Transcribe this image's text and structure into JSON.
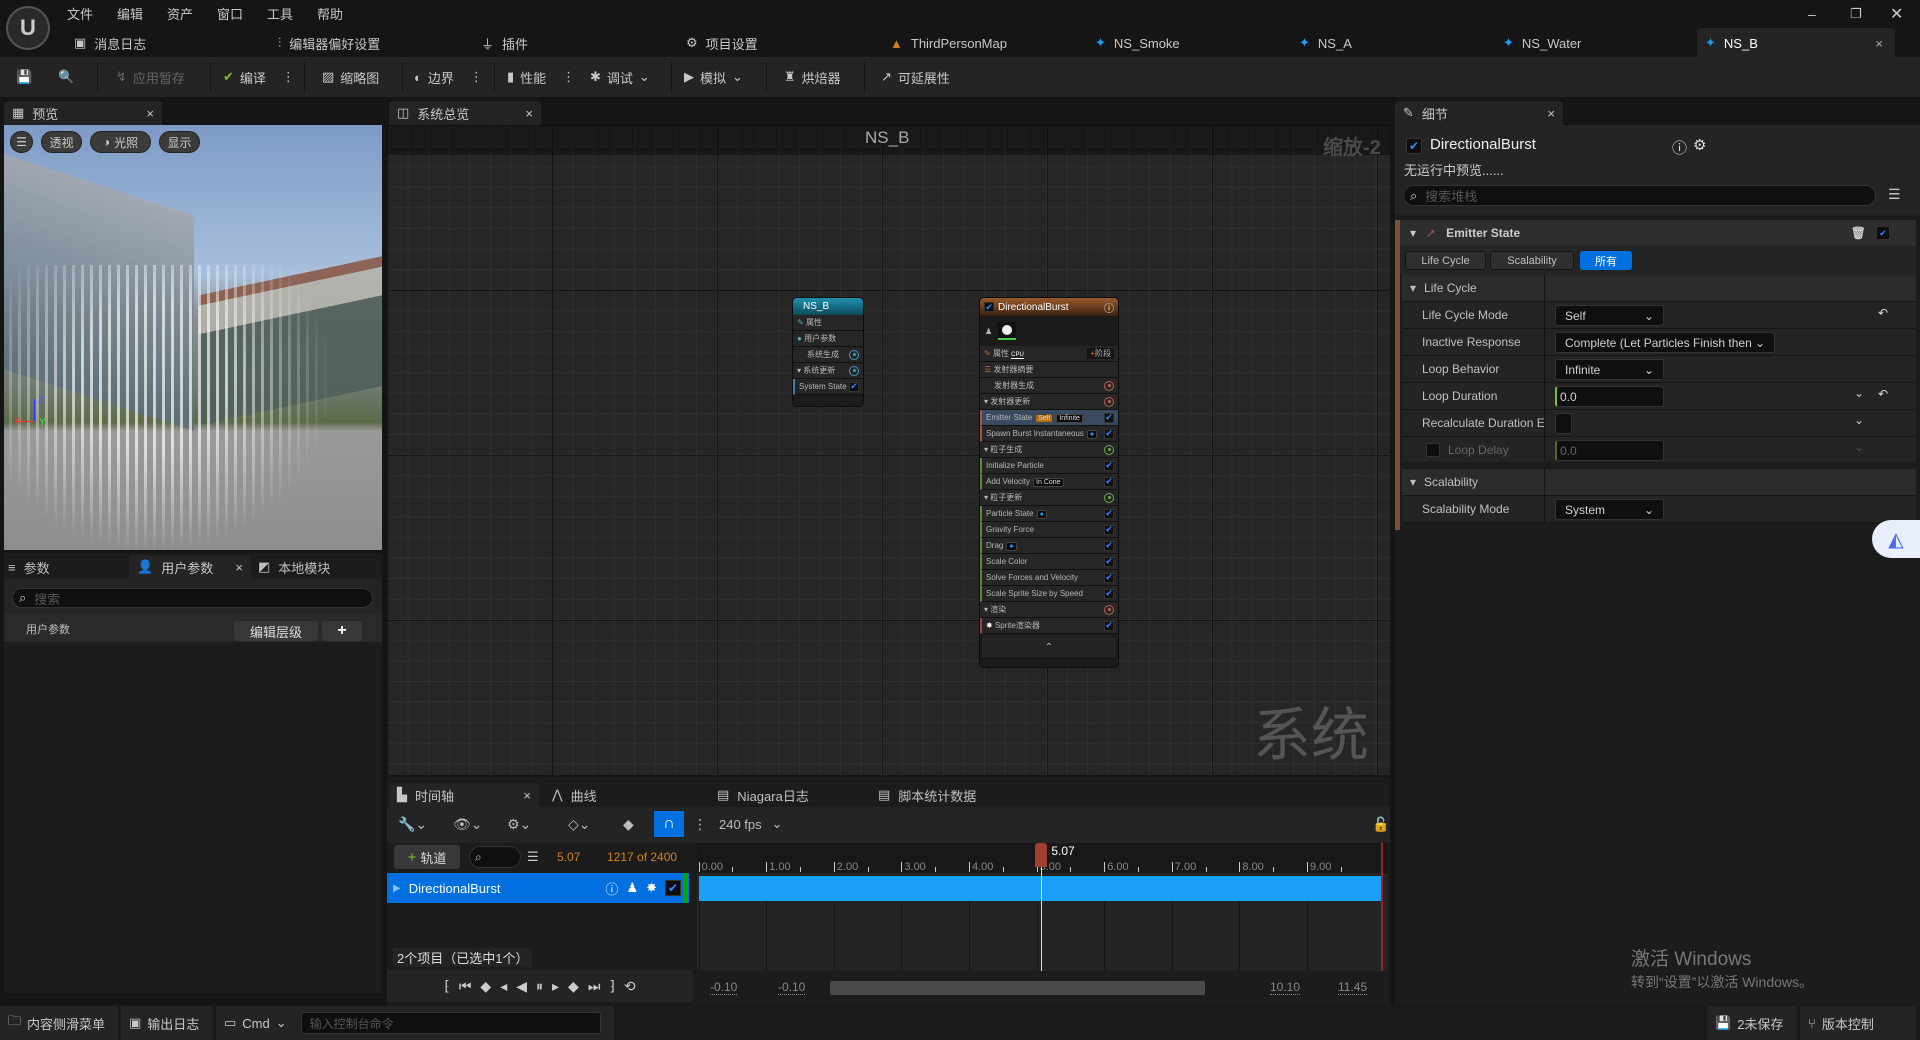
{
  "menu": [
    "文件",
    "编辑",
    "资产",
    "窗口",
    "工具",
    "帮助"
  ],
  "doc_tabs": [
    "消息日志",
    "编辑器偏好设置",
    "插件",
    "项目设置",
    "ThirdPersonMap",
    "NS_Smoke",
    "NS_A",
    "NS_Water",
    "NS_B"
  ],
  "toolbar": {
    "apply": "应用暂存",
    "compile": "编译",
    "thumbnail": "缩略图",
    "bounds": "边界",
    "performance": "性能",
    "debug": "调试",
    "simulate": "模拟",
    "baker": "烘焙器",
    "scalability": "可延展性"
  },
  "preview": {
    "tab": "预览",
    "perspective": "透视",
    "lit": "光照",
    "show": "显示",
    "axes": {
      "x": "X",
      "y": "Y",
      "z": "Z"
    }
  },
  "params": {
    "tabs": [
      "参数",
      "用户参数",
      "本地模块"
    ],
    "search_placeholder": "搜索",
    "row_label": "用户参数",
    "edit_hierarchy": "编辑层级",
    "add": "+"
  },
  "graph": {
    "tab": "系统总览",
    "title": "NS_B",
    "zoom": "缩放-2",
    "watermark": "系统"
  },
  "system_node": {
    "title": "NS_B",
    "rows": [
      "属性",
      "用户参数",
      "系统生成",
      "系统更新",
      "System State"
    ]
  },
  "emitter_node": {
    "title": "DirectionalBurst",
    "properties": "属性",
    "cpu": "CPU",
    "stage": "阶段",
    "rows": [
      {
        "t": "发射器摘要",
        "k": "sec0"
      },
      {
        "t": "发射器生成",
        "k": "sec"
      },
      {
        "t": "发射器更新",
        "k": "secx",
        "c": "#c0604a"
      },
      {
        "t": "Emitter State",
        "k": "mod",
        "tags": [
          "Self",
          "Infinite"
        ],
        "sel": true
      },
      {
        "t": "Spawn Burst Instantaneous",
        "k": "mod",
        "dot": true
      },
      {
        "t": "粒子生成",
        "k": "secx",
        "c": "#6aa84f"
      },
      {
        "t": "Initialize Particle",
        "k": "mod"
      },
      {
        "t": "Add Velocity",
        "k": "mod",
        "tags": [
          "In Cone"
        ]
      },
      {
        "t": "粒子更新",
        "k": "secx",
        "c": "#6aa84f"
      },
      {
        "t": "Particle State",
        "k": "mod",
        "dot": true
      },
      {
        "t": "Gravity Force",
        "k": "mod"
      },
      {
        "t": "Drag",
        "k": "mod",
        "dot": true
      },
      {
        "t": "Scale Color",
        "k": "mod"
      },
      {
        "t": "Solve Forces and Velocity",
        "k": "mod"
      },
      {
        "t": "Scale Sprite Size by Speed",
        "k": "mod"
      },
      {
        "t": "渲染",
        "k": "secx",
        "c": "#c0604a"
      },
      {
        "t": "Sprite渲染器",
        "k": "mod"
      }
    ]
  },
  "details": {
    "tab": "细节",
    "title": "DirectionalBurst",
    "subtitle": "无运行中预览......",
    "search_placeholder": "搜索堆栈",
    "module": "Emitter State",
    "filters": [
      "Life Cycle",
      "Scalability",
      "所有"
    ],
    "life_cycle": {
      "header": "Life Cycle",
      "rows": [
        {
          "label": "Life Cycle Mode",
          "value": "Self"
        },
        {
          "label": "Inactive Response",
          "value": "Complete (Let Particles Finish then"
        },
        {
          "label": "Loop Behavior",
          "value": "Infinite"
        },
        {
          "label": "Loop Duration",
          "value": "0.0"
        },
        {
          "label": "Recalculate Duration Ea",
          "value": ""
        },
        {
          "label": "Loop Delay",
          "value": "0.0"
        }
      ]
    },
    "scalability": {
      "header": "Scalability",
      "mode_label": "Scalability Mode",
      "mode_value": "System"
    }
  },
  "timeline": {
    "tabs": [
      "时间轴",
      "曲线",
      "Niagara日志",
      "脚本统计数据"
    ],
    "fps": "240 fps",
    "add_track": "轨道",
    "current_time": "5.07",
    "frame": "1217 of 2400",
    "track": "DirectionalBurst",
    "items": "2个项目（已选中1个）",
    "ticks": [
      "0.00",
      "1.00",
      "2.00",
      "3.00",
      "4.00",
      "5.00",
      "6.00",
      "7.00",
      "8.00",
      "9.00"
    ],
    "playhead": 5.07,
    "end": 10.1,
    "view_start": "-0.10",
    "play_start": "-0.10",
    "play_end": "10.10",
    "view_end": "11.45"
  },
  "statusbar": {
    "content_drawer": "内容侧滑菜单",
    "output_log": "输出日志",
    "cmd": "Cmd",
    "console_placeholder": "输入控制台命令",
    "unsaved": "2未保存",
    "source_control": "版本控制"
  },
  "windows_activation": {
    "title": "激活 Windows",
    "subtitle": "转到“设置”以激活 Windows。"
  },
  "colors": {
    "accent": "#0070e0",
    "track": "#1aa0f8",
    "playhead": "#a04030",
    "frame_text": "#d08020",
    "emitter_header": "#8a4a20",
    "system_header": "#1a6a80"
  }
}
